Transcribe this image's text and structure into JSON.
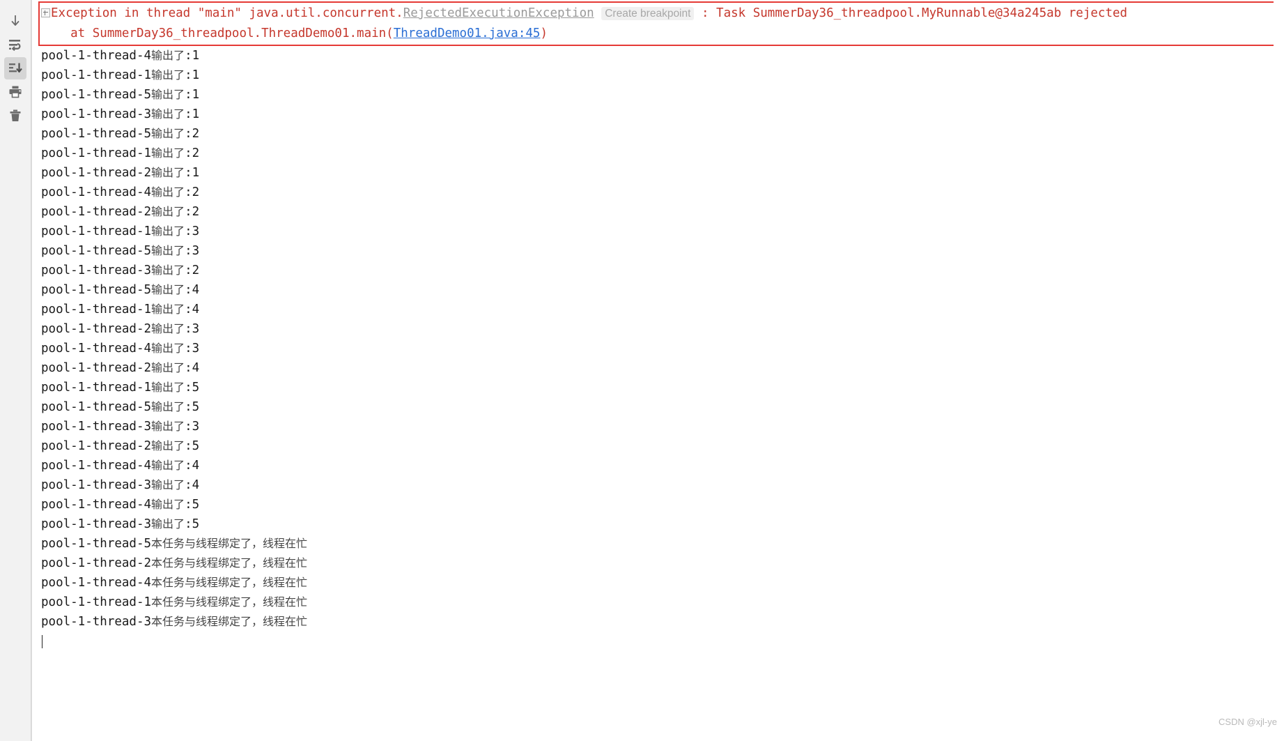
{
  "toolbar": {
    "items": [
      {
        "name": "scroll-down-icon",
        "tooltip": "Scroll to the end"
      },
      {
        "name": "soft-wrap-icon",
        "tooltip": "Soft-Wrap"
      },
      {
        "name": "scroll-to-end-icon",
        "tooltip": "Scroll to End",
        "active": true
      },
      {
        "name": "print-icon",
        "tooltip": "Print"
      },
      {
        "name": "trash-icon",
        "tooltip": "Clear All"
      }
    ]
  },
  "exception": {
    "border_color": "#e53935",
    "text_color": "#c5372c",
    "line1": {
      "prefix": "Exception in thread \"main\" java.util.concurrent.",
      "exception_type": "RejectedExecutionException",
      "breakpoint_label": "Create breakpoint",
      "suffix": " : Task SummerDay36_threadpool.MyRunnable@34a245ab rejected "
    },
    "line2": {
      "prefix": "    at SummerDay36_threadpool.ThreadDemo01.main(",
      "link": "ThreadDemo01.java:45",
      "suffix": ")"
    }
  },
  "console": {
    "lines": [
      {
        "thread": "pool-1-thread-4",
        "cjk": "输出了",
        "value": ":1"
      },
      {
        "thread": "pool-1-thread-1",
        "cjk": "输出了",
        "value": ":1"
      },
      {
        "thread": "pool-1-thread-5",
        "cjk": "输出了",
        "value": ":1"
      },
      {
        "thread": "pool-1-thread-3",
        "cjk": "输出了",
        "value": ":1"
      },
      {
        "thread": "pool-1-thread-5",
        "cjk": "输出了",
        "value": ":2"
      },
      {
        "thread": "pool-1-thread-1",
        "cjk": "输出了",
        "value": ":2"
      },
      {
        "thread": "pool-1-thread-2",
        "cjk": "输出了",
        "value": ":1"
      },
      {
        "thread": "pool-1-thread-4",
        "cjk": "输出了",
        "value": ":2"
      },
      {
        "thread": "pool-1-thread-2",
        "cjk": "输出了",
        "value": ":2"
      },
      {
        "thread": "pool-1-thread-1",
        "cjk": "输出了",
        "value": ":3"
      },
      {
        "thread": "pool-1-thread-5",
        "cjk": "输出了",
        "value": ":3"
      },
      {
        "thread": "pool-1-thread-3",
        "cjk": "输出了",
        "value": ":2"
      },
      {
        "thread": "pool-1-thread-5",
        "cjk": "输出了",
        "value": ":4"
      },
      {
        "thread": "pool-1-thread-1",
        "cjk": "输出了",
        "value": ":4"
      },
      {
        "thread": "pool-1-thread-2",
        "cjk": "输出了",
        "value": ":3"
      },
      {
        "thread": "pool-1-thread-4",
        "cjk": "输出了",
        "value": ":3"
      },
      {
        "thread": "pool-1-thread-2",
        "cjk": "输出了",
        "value": ":4"
      },
      {
        "thread": "pool-1-thread-1",
        "cjk": "输出了",
        "value": ":5"
      },
      {
        "thread": "pool-1-thread-5",
        "cjk": "输出了",
        "value": ":5"
      },
      {
        "thread": "pool-1-thread-3",
        "cjk": "输出了",
        "value": ":3"
      },
      {
        "thread": "pool-1-thread-2",
        "cjk": "输出了",
        "value": ":5"
      },
      {
        "thread": "pool-1-thread-4",
        "cjk": "输出了",
        "value": ":4"
      },
      {
        "thread": "pool-1-thread-3",
        "cjk": "输出了",
        "value": ":4"
      },
      {
        "thread": "pool-1-thread-4",
        "cjk": "输出了",
        "value": ":5"
      },
      {
        "thread": "pool-1-thread-3",
        "cjk": "输出了",
        "value": ":5"
      },
      {
        "thread": "pool-1-thread-5",
        "cjk": "本任务与线程绑定了，线程在忙",
        "value": ""
      },
      {
        "thread": "pool-1-thread-2",
        "cjk": "本任务与线程绑定了，线程在忙",
        "value": ""
      },
      {
        "thread": "pool-1-thread-4",
        "cjk": "本任务与线程绑定了，线程在忙",
        "value": ""
      },
      {
        "thread": "pool-1-thread-1",
        "cjk": "本任务与线程绑定了，线程在忙",
        "value": ""
      },
      {
        "thread": "pool-1-thread-3",
        "cjk": "本任务与线程绑定了，线程在忙",
        "value": ""
      }
    ]
  },
  "watermark": "CSDN @xjl-ye"
}
